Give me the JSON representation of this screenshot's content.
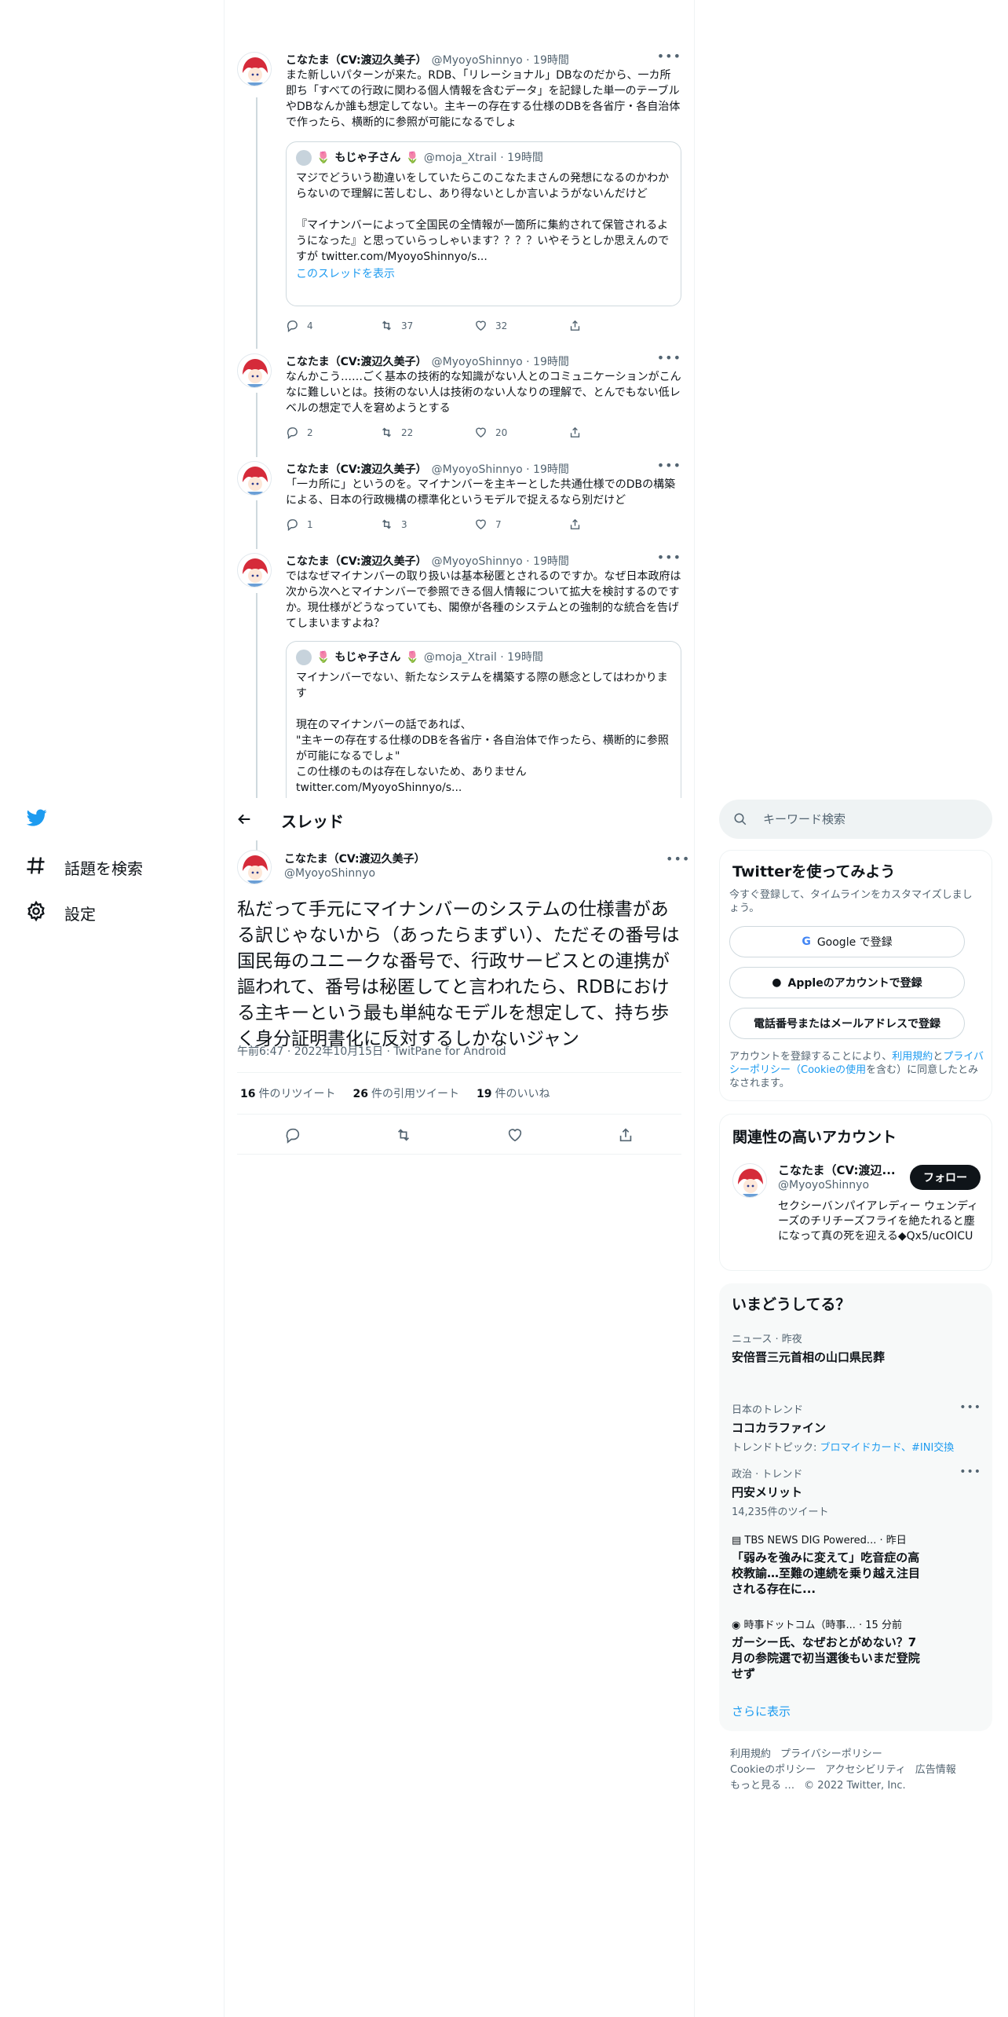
{
  "nav": {
    "explore": "話題を検索",
    "settings": "設定"
  },
  "thread_tweets": [
    {
      "name": "こなたま（CV:渡辺久美子）",
      "handle": "@MyoyoShinnyo · 19時間",
      "text": "また新しいパターンが来た。RDB、「リレーショナル」DBなのだから、一カ所即ち「すべての行政に関わる個人情報を含むデータ」を記録した単一のテーブルやDBなんか誰も想定してない。主キーの存在する仕様のDBを各省庁・各自治体で作ったら、横断的に参照が可能になるでしょ",
      "quote": {
        "name": "もじゃ子さん",
        "handle": "@moja_Xtrail · 19時間",
        "text": "マジでどういう勘違いをしていたらこのこなたまさんの発想になるのかわからないので理解に苦しむし、あり得ないとしか言いようがないんだけど\n\n『マイナンバーによって全国民の全情報が一箇所に集約されて保管されるようになった』と思っていらっしゃいます？？？？いやそうとしか思えんのですが twitter.com/MyoyoShinnyo/s...",
        "link": "このスレッドを表示"
      },
      "replies": "4",
      "retweets": "37",
      "likes": "32"
    },
    {
      "name": "こなたま（CV:渡辺久美子）",
      "handle": "@MyoyoShinnyo · 19時間",
      "text": "なんかこう……ごく基本の技術的な知識がない人とのコミュニケーションがこんなに難しいとは。技術のない人は技術のない人なりの理解で、とんでもない低レベルの想定で人を窘めようとする",
      "replies": "2",
      "retweets": "22",
      "likes": "20"
    },
    {
      "name": "こなたま（CV:渡辺久美子）",
      "handle": "@MyoyoShinnyo · 19時間",
      "text": "「一カ所に」というのを。マイナンバーを主キーとした共通仕様でのDBの構築による、日本の行政機構の標準化というモデルで捉えるなら別だけど",
      "replies": "1",
      "retweets": "3",
      "likes": "7"
    },
    {
      "name": "こなたま（CV:渡辺久美子）",
      "handle": "@MyoyoShinnyo · 19時間",
      "text": "ではなぜマイナンバーの取り扱いは基本秘匿とされるのですか。なぜ日本政府は次から次へとマイナンバーで参照できる個人情報について拡大を検討するのですか。現仕様がどうなっていても、閣僚が各種のシステムとの強制的な統合を告げてしまいますよね？",
      "quote": {
        "name": "もじゃ子さん",
        "handle": "@moja_Xtrail · 19時間",
        "text": "マイナンバーでない、新たなシステムを構築する際の懸念としてはわかります\n\n現在のマイナンバーの話であれば、\n\"主キーの存在する仕様のDBを各省庁・各自治体で作ったら、横断的に参照が可能になるでしょ\"\nこの仕様のものは存在しないため、ありません\ntwitter.com/MyoyoShinnyo/s..."
      }
    }
  ],
  "thread_header": {
    "title": "スレッド"
  },
  "main_tweet": {
    "name": "こなたま（CV:渡辺久美子）",
    "handle": "@MyoyoShinnyo",
    "text": "私だって手元にマイナンバーのシステムの仕様書がある訳じゃないから（あったらまずい）、ただその番号は国民毎のユニークな番号で、行政サービスとの連携が謳われて、番号は秘匿してと言われたら、RDBにおける主キーという最も単純なモデルを想定して、持ち歩く身分証明書化に反対するしかないジャン",
    "meta": "午前6:47 · 2022年10月15日 · TwitPane for Android",
    "retweets": "16",
    "retweets_label": "件のリツイート",
    "quotes": "26",
    "quotes_label": "件の引用ツイート",
    "likes": "19",
    "likes_label": "件のいいね"
  },
  "search": {
    "placeholder": "キーワード検索"
  },
  "signup": {
    "title": "Twitterを使ってみよう",
    "subtitle": "今すぐ登録して、タイムラインをカスタマイズしましょう。",
    "google": "Google で登録",
    "apple": "Appleのアカウントで登録",
    "phone": "電話番号またはメールアドレスで登録",
    "terms_prefix": "アカウントを登録することにより、",
    "terms_link1": "利用規約",
    "terms_mid": "と",
    "terms_link2": "プライバシーポリシー（Cookieの使用",
    "terms_suffix": "を含む）に同意したとみなされます。"
  },
  "related": {
    "title": "関連性の高いアカウント",
    "name": "こなたま（CV:渡辺...",
    "handle": "@MyoyoShinnyo",
    "follow": "フォロー",
    "bio": "セクシーバンパイアレディー ウェンディーズのチリチーズフライを絶たれると塵になって真の死を迎える◆Qx5/ucOICU"
  },
  "trends": {
    "title": "いまどうしてる？",
    "items": [
      {
        "category": "ニュース · 昨夜",
        "name": "安倍晋三元首相の山口県民葬"
      },
      {
        "category": "日本のトレンド",
        "name": "ココカラファイン",
        "sub_prefix": "トレンドトピック: ",
        "sub_links": "ブロマイドカード、#INI交換"
      },
      {
        "category": "政治 · トレンド",
        "name": "円安メリット",
        "sub": "14,235件のツイート"
      },
      {
        "category": "TBS NEWS DIG Powered... · 昨日",
        "name": "「弱みを強みに変えて」吃音症の高校教諭…至難の連続を乗り越え注目される存在に..."
      },
      {
        "category": "時事ドットコム（時事... · 15 分前",
        "name": "ガーシー氏、なぜおとがめない？7月の参院選で初当選後もいまだ登院せず"
      }
    ],
    "show_more": "さらに表示"
  },
  "footer": {
    "terms": "利用規約",
    "privacy": "プライバシーポリシー",
    "cookie": "Cookieのポリシー",
    "accessibility": "アクセシビリティ",
    "ads": "広告情報",
    "more": "もっと見る …",
    "copyright": "© 2022 Twitter, Inc."
  },
  "colors": {
    "accent": "#1d9bf0",
    "text": "#0f1419",
    "muted": "#536471",
    "border": "#eff3f4"
  }
}
